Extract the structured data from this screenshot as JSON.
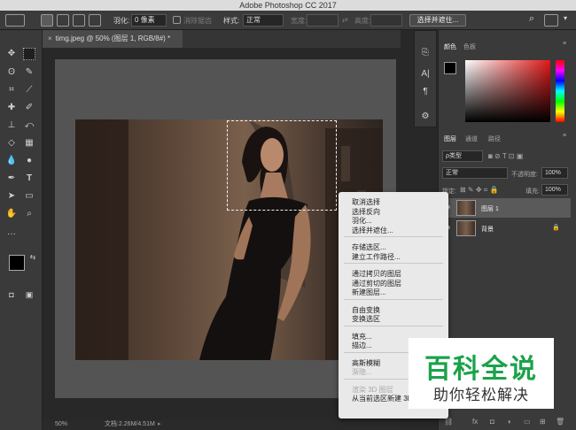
{
  "app": {
    "title": "Adobe Photoshop CC 2017"
  },
  "options": {
    "feather_label": "羽化:",
    "feather_value": "0 像素",
    "antialias_label": "消除锯齿",
    "style_label": "样式:",
    "style_value": "正常",
    "width_label": "宽度:",
    "height_label": "高度:",
    "select_mask_button": "选择并遮住..."
  },
  "document": {
    "tab_title": "timg.jpeg @ 50% (图层 1, RGB/8#) *",
    "zoom": "50%",
    "doc_info": "文档:2.26M/4.51M"
  },
  "panels": {
    "color_tab": "颜色",
    "swatches_tab": "色板",
    "layers_tab": "图层",
    "channels_tab": "通道",
    "paths_tab": "路径",
    "filter_kind": "ρ类型",
    "blend_mode": "正常",
    "opacity_label": "不透明度:",
    "opacity_value": "100%",
    "lock_label": "锁定:",
    "fill_label": "填充:",
    "fill_value": "100%",
    "layers": [
      {
        "name": "图层 1",
        "active": true
      },
      {
        "name": "背景",
        "active": false
      }
    ]
  },
  "context_menu": {
    "groups": [
      [
        {
          "label": "取消选择"
        },
        {
          "label": "选择反向"
        },
        {
          "label": "羽化..."
        },
        {
          "label": "选择并遮住..."
        }
      ],
      [
        {
          "label": "存储选区..."
        },
        {
          "label": "建立工作路径..."
        }
      ],
      [
        {
          "label": "通过拷贝的图层"
        },
        {
          "label": "通过剪切的图层"
        },
        {
          "label": "新建图层..."
        }
      ],
      [
        {
          "label": "自由变换"
        },
        {
          "label": "变换选区"
        }
      ],
      [
        {
          "label": "填充..."
        },
        {
          "label": "描边..."
        }
      ],
      [
        {
          "label": "高斯模糊"
        },
        {
          "label": "渐隐...",
          "disabled": true
        }
      ],
      [
        {
          "label": "渲染 3D 图层",
          "disabled": true
        },
        {
          "label": "从当前选区新建 3D 模型"
        }
      ]
    ]
  },
  "watermark": {
    "title": "百科全说",
    "subtitle": "助你轻松解决",
    "color": "#1aa34a"
  },
  "colors": {
    "foreground": "#000000",
    "background": "#ffffff"
  }
}
